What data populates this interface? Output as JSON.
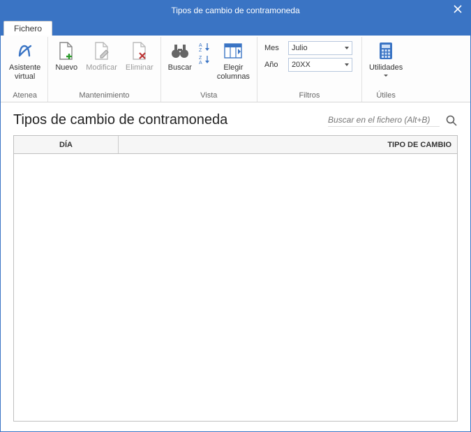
{
  "window": {
    "title": "Tipos de cambio de contramoneda"
  },
  "tabs": [
    {
      "label": "Fichero"
    }
  ],
  "ribbon": {
    "atenea": {
      "title": "Atenea",
      "assistant": "Asistente\nvirtual"
    },
    "mantenimiento": {
      "title": "Mantenimiento",
      "nuevo": "Nuevo",
      "modificar": "Modificar",
      "eliminar": "Eliminar"
    },
    "vista": {
      "title": "Vista",
      "buscar": "Buscar",
      "ordenar": "",
      "elegir": "Elegir\ncolumnas"
    },
    "filtros": {
      "title": "Filtros",
      "mes_label": "Mes",
      "mes_value": "Julio",
      "anio_label": "Año",
      "anio_value": "20XX"
    },
    "utiles": {
      "title": "Útiles",
      "utilidades": "Utilidades"
    }
  },
  "page": {
    "title": "Tipos de cambio de contramoneda",
    "search_placeholder": "Buscar en el fichero (Alt+B)"
  },
  "grid": {
    "columns": {
      "dia": "DÍA",
      "tipo": "TIPO DE CAMBIO"
    },
    "rows": []
  }
}
